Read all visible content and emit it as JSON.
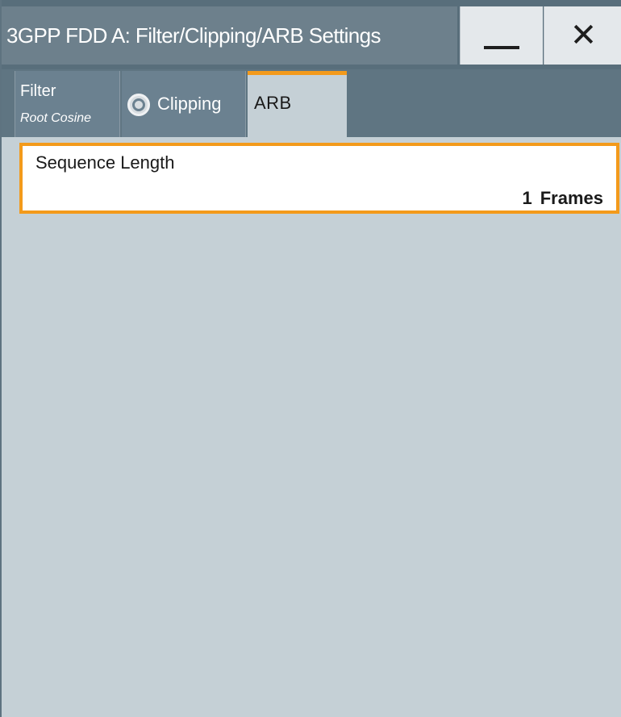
{
  "window": {
    "title": "3GPP FDD A: Filter/Clipping/ARB Settings",
    "minimize_icon": "minimize-icon",
    "close_icon": "close-icon"
  },
  "tabs": [
    {
      "label": "Filter",
      "sublabel": "Root Cosine",
      "active": false
    },
    {
      "label": "Clipping",
      "radio_state": "off",
      "active": false
    },
    {
      "label": "ARB",
      "active": true
    }
  ],
  "arb": {
    "sequence_length": {
      "label": "Sequence Length",
      "value": "1",
      "unit": "Frames"
    }
  },
  "colors": {
    "accent": "#f39a1b",
    "titlebar": "#586e7b",
    "tabbar": "#5f7582",
    "panel_bg": "#c5d0d6"
  }
}
